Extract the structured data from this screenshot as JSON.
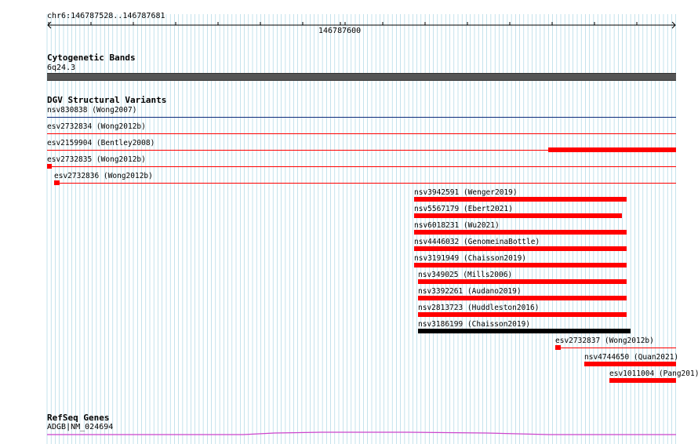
{
  "ruler": {
    "range_label": "chr6:146787528..146787681",
    "tick_label": "146787600"
  },
  "cytoband": {
    "title": "Cytogenetic Bands",
    "band_label": "6q24.3"
  },
  "dgv": {
    "title": "DGV Structural Variants",
    "features": [
      {
        "name": "nsv830838",
        "study": "Wong2007",
        "color": "#0a2a7a"
      },
      {
        "name": "esv2732834",
        "study": "Wong2012b",
        "color": "#ff0000"
      },
      {
        "name": "esv2159904",
        "study": "Bentley2008",
        "color": "#ff0000"
      },
      {
        "name": "esv2732835",
        "study": "Wong2012b",
        "color": "#ff0000"
      },
      {
        "name": "esv2732836",
        "study": "Wong2012b",
        "color": "#ff0000"
      },
      {
        "name": "nsv3942591",
        "study": "Wenger2019",
        "color": "#ff0000"
      },
      {
        "name": "nsv5567179",
        "study": "Ebert2021",
        "color": "#ff0000"
      },
      {
        "name": "nsv6018231",
        "study": "Wu2021",
        "color": "#ff0000"
      },
      {
        "name": "nsv4446032",
        "study": "GenomeinaBottle",
        "color": "#ff0000"
      },
      {
        "name": "nsv3191949",
        "study": "Chaisson2019",
        "color": "#ff0000"
      },
      {
        "name": "nsv349025",
        "study": "Mills2006",
        "color": "#ff0000"
      },
      {
        "name": "nsv3392261",
        "study": "Audano2019",
        "color": "#ff0000"
      },
      {
        "name": "nsv2813723",
        "study": "Huddleston2016",
        "color": "#ff0000"
      },
      {
        "name": "nsv3186199",
        "study": "Chaisson2019",
        "color": "#000000"
      },
      {
        "name": "esv2732837",
        "study": "Wong2012b",
        "color": "#ff0000"
      },
      {
        "name": "nsv4744650",
        "study": "Quan2021",
        "color": "#ff0000"
      },
      {
        "name": "esv1011004",
        "study": "Pang201",
        "color": "#ff0000"
      }
    ]
  },
  "refseq": {
    "title": "RefSeq Genes",
    "gene_label": "ADGB|NM_024694",
    "color": "#cc44cc"
  },
  "colors": {
    "grid": "#9fd0e0",
    "band": "#555555",
    "sv_gain": "#ff0000",
    "sv_complex": "#000000"
  }
}
